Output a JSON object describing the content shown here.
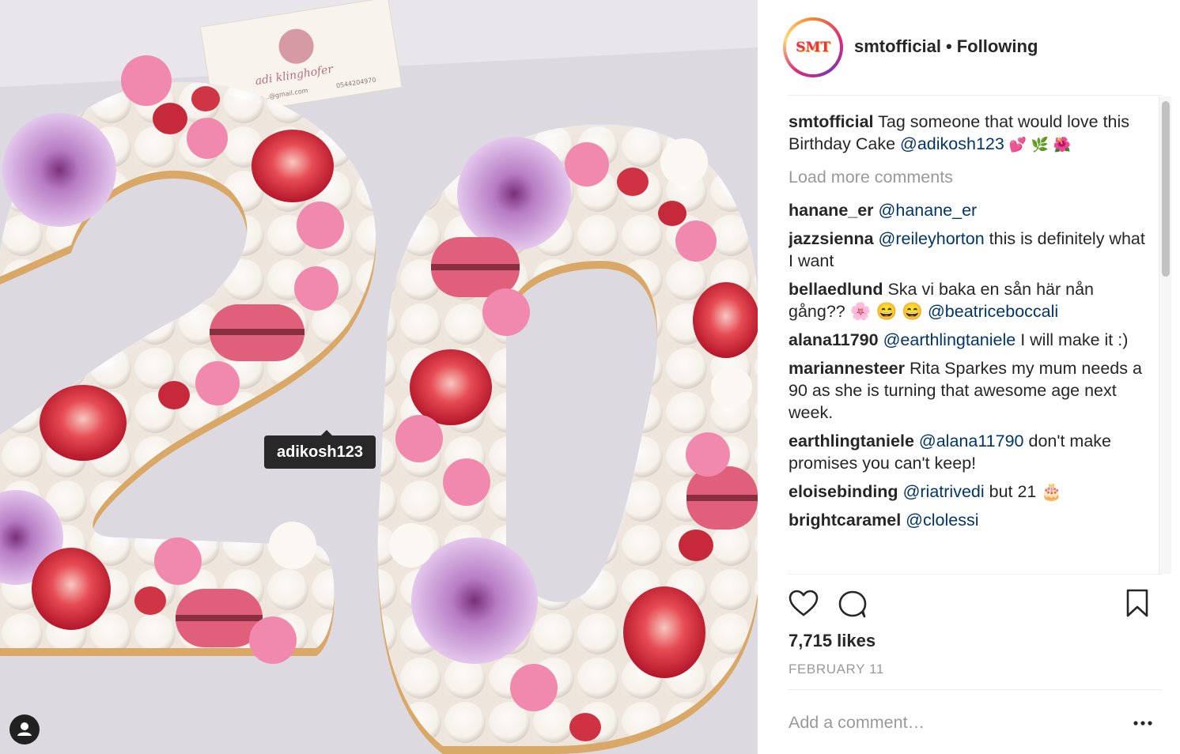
{
  "post": {
    "image_tag": "adikosh123",
    "image_text": {
      "sign_name": "adi klinghofer",
      "sign_email": "adiklin...@gmail.com",
      "sign_phone": "0544204970"
    }
  },
  "header": {
    "avatar_text": "SMT",
    "username": "smtofficial",
    "separator": "•",
    "follow_status": "Following"
  },
  "caption": {
    "user": "smtofficial",
    "text": " Tag someone that would love this Birthday Cake ",
    "mention": "@adikosh123",
    "emoji": " 💕 🌿 🌺"
  },
  "load_more": "Load more comments",
  "comments": [
    {
      "user": "hanane_er",
      "pre": " ",
      "mention": "@hanane_er",
      "post": ""
    },
    {
      "user": "jazzsienna",
      "pre": " ",
      "mention": "@reileyhorton",
      "post": " this is definitely what I want"
    },
    {
      "user": "bellaedlund",
      "pre": " Ska vi baka en sån här nån gång?? 🌸 😄 😄  ",
      "mention": "@beatriceboccali",
      "post": ""
    },
    {
      "user": "alana11790",
      "pre": " ",
      "mention": "@earthlingtaniele",
      "post": " I will make it :)"
    },
    {
      "user": "mariannesteer",
      "pre": " Rita Sparkes my mum needs a 90 as she is turning that awesome age next week.",
      "mention": "",
      "post": ""
    },
    {
      "user": "earthlingtaniele",
      "pre": " ",
      "mention": "@alana11790",
      "post": " don't make promises you can't keep!"
    },
    {
      "user": "eloisebinding",
      "pre": " ",
      "mention": "@riatrivedi",
      "post": " but 21 🎂"
    },
    {
      "user": "brightcaramel",
      "pre": " ",
      "mention": "@clolessi",
      "post": ""
    }
  ],
  "actions": {
    "icons": [
      "heart-icon",
      "comment-icon",
      "bookmark-icon"
    ]
  },
  "likes": "7,715 likes",
  "date": "FEBRUARY 11",
  "add_comment": {
    "placeholder": "Add a comment…"
  },
  "more_options": "•••",
  "colors": {
    "mention": "#003569",
    "muted": "#999999",
    "text": "#262626",
    "divider": "#efefef"
  }
}
